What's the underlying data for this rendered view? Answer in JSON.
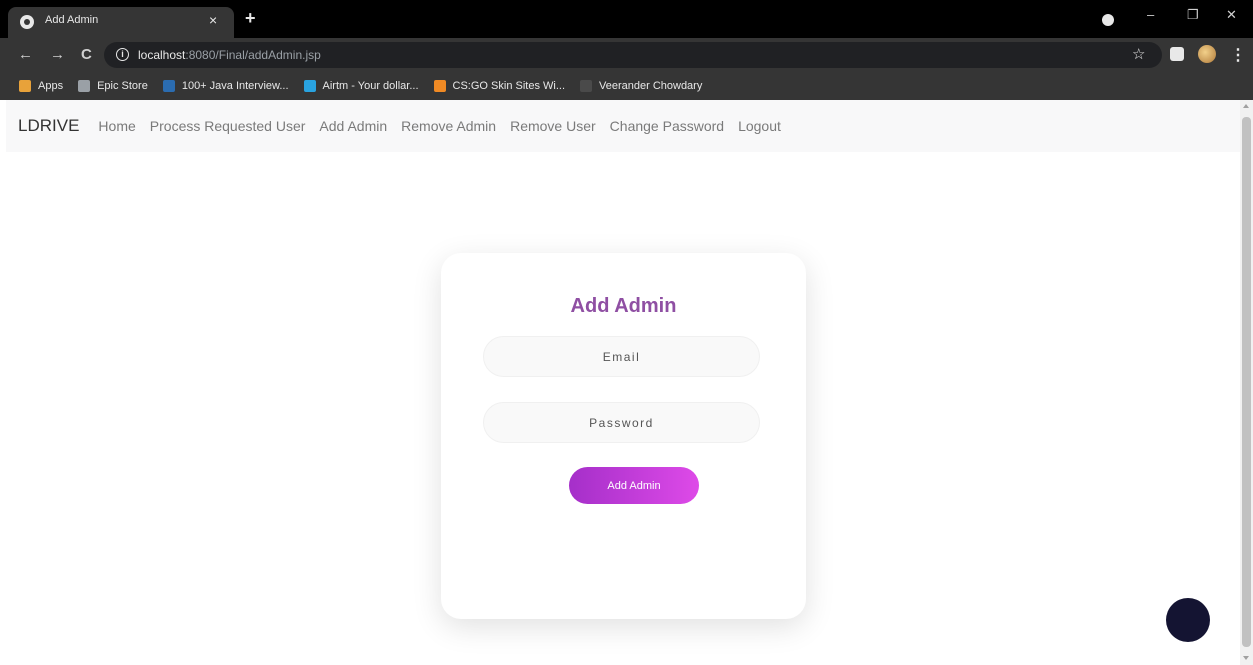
{
  "browser": {
    "tab_title": "Add Admin",
    "tab_close": "×",
    "new_tab": "+",
    "url_host": "localhost",
    "url_rest": ":8080/Final/addAdmin.jsp",
    "controls": {
      "back": "←",
      "forward": "→",
      "reload": "C",
      "info": "i",
      "star": "☆",
      "menu": "⋮",
      "minimize": "–",
      "restore": "❐",
      "close": "✕"
    }
  },
  "bookmarks": [
    {
      "label": "Apps",
      "icon": "apps-grid-icon",
      "color": "#e8a23a"
    },
    {
      "label": "Epic Store",
      "icon": "epic-store-icon",
      "color": "#9aa0a6"
    },
    {
      "label": "100+ Java Interview...",
      "icon": "java-site-icon",
      "color": "#2b6cb0"
    },
    {
      "label": "Airtm - Your dollar...",
      "icon": "airtm-icon",
      "color": "#29a3e0"
    },
    {
      "label": "CS:GO Skin Sites Wi...",
      "icon": "csgo-icon",
      "color": "#f08a24"
    },
    {
      "label": "Veerander Chowdary",
      "icon": "page-icon",
      "color": "#4a4a4a"
    }
  ],
  "navbar": {
    "brand": "LDRIVE",
    "links": [
      "Home",
      "Process Requested User",
      "Add Admin",
      "Remove Admin",
      "Remove User",
      "Change Password",
      "Logout"
    ]
  },
  "form": {
    "title": "Add Admin",
    "email_placeholder": "Email",
    "password_placeholder": "Password",
    "submit_label": "Add Admin"
  },
  "colors": {
    "accent_title": "#8f4fa3",
    "button_gradient_start": "#a52fc9",
    "button_gradient_end": "#de4ae8",
    "fab": "#141432"
  }
}
